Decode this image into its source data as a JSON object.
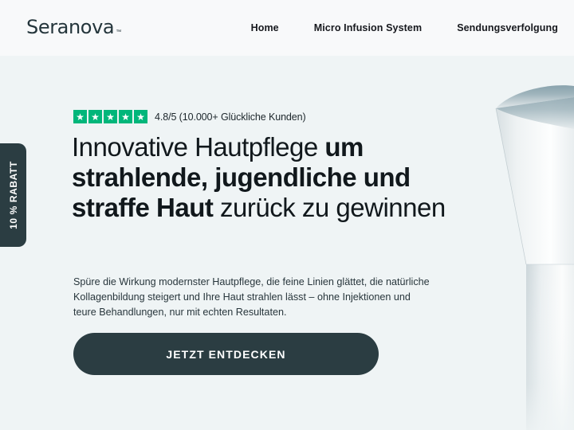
{
  "brand": {
    "logo_text": "Seranova",
    "trademark": "™",
    "logo_color": "#24353b"
  },
  "nav": {
    "items": [
      {
        "label": "Home"
      },
      {
        "label": "Micro Infusion System"
      },
      {
        "label": "Sendungsverfolgung"
      }
    ]
  },
  "promo_tab": {
    "label": "10 % RABATT",
    "background": "#2b3d42"
  },
  "hero": {
    "rating": {
      "stars": 5,
      "star_color": "#00b67a",
      "star_icon": "star-icon",
      "text": "4.8/5 (10.000+ Glückliche Kunden)",
      "score": "4.8/5",
      "customers": "10.000+ Glückliche Kunden"
    },
    "headline": {
      "part1": "Innovative Hautpflege ",
      "part2_bold": "um strahlende, jugendliche und straffe Haut",
      "part3": " zurück zu gewinnen"
    },
    "subcopy": "Spüre die Wirkung modernster Hautpflege, die feine Linien glättet, die natürliche Kollagenbildung steigert und Ihre Haut strahlen lässt – ohne Injektionen und teure Behandlungen, nur mit echten Resultaten.",
    "cta_label": "JETZT ENTDECKEN",
    "cta_color": "#2b3d42"
  },
  "product_image": {
    "alt": "micro-infusion-device",
    "cap_shadow_color": "#6d8590",
    "body_color": "#ffffff"
  },
  "colors": {
    "page_background": "#eff4f5",
    "header_background": "#f8f9fa",
    "text_dark": "#11181c",
    "accent_green": "#00b67a"
  }
}
